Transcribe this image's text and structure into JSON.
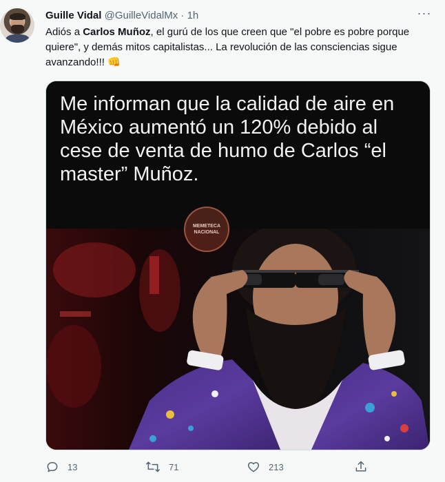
{
  "tweet": {
    "author_name": "Guille Vidal",
    "author_handle": "@GuilleVidalMx",
    "separator": "·",
    "time": "1h",
    "more_label": "···",
    "text_before": "Adiós a ",
    "text_bold": "Carlos Muñoz",
    "text_after": ", el gurú de los que creen que \"el pobre es pobre porque quiere\", y demás mitos capitalistas... La revolución de las consciencias sigue avanzando!!! ",
    "emoji": "👊"
  },
  "media": {
    "caption": "Me informan que la calidad de aire en México aumentó un 120% debido al cese de venta de humo de Carlos “el master” Muñoz.",
    "watermark": "MEMETECA NACIONAL"
  },
  "actions": {
    "replies": "13",
    "retweets": "71",
    "likes": "213"
  },
  "icons": [
    "reply-icon",
    "retweet-icon",
    "like-icon",
    "share-icon",
    "more-icon"
  ],
  "colors": {
    "background": "#f7f9f9",
    "text": "#0f1419",
    "secondary": "#536471",
    "border": "#cfd9de"
  }
}
